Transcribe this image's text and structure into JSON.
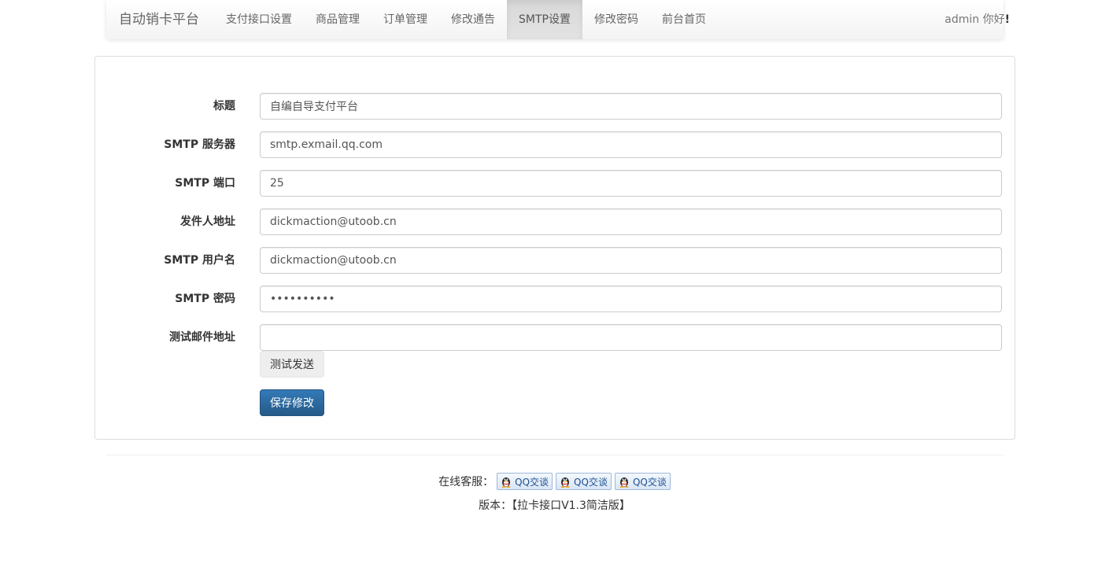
{
  "navbar": {
    "brand": "自动销卡平台",
    "items": [
      {
        "label": "支付接口设置"
      },
      {
        "label": "商品管理"
      },
      {
        "label": "订单管理"
      },
      {
        "label": "修改通告"
      },
      {
        "label": "SMTP设置",
        "active": true
      },
      {
        "label": "修改密码"
      },
      {
        "label": "前台首页"
      }
    ],
    "user_greeting": "admin 你好",
    "user_suffix": "!"
  },
  "form": {
    "fields": [
      {
        "label": "标题",
        "value": "自编自导支付平台"
      },
      {
        "label": "SMTP 服务器",
        "value": "smtp.exmail.qq.com"
      },
      {
        "label": "SMTP 端口",
        "value": "25"
      },
      {
        "label": "发件人地址",
        "value": "dickmaction@utoob.cn"
      },
      {
        "label": "SMTP 用户名",
        "value": "dickmaction@utoob.cn"
      },
      {
        "label": "SMTP 密码",
        "value": "••••••••••"
      },
      {
        "label": "测试邮件地址",
        "value": ""
      }
    ],
    "test_send_label": "测试发送",
    "save_label": "保存修改"
  },
  "footer": {
    "service_label": "在线客服：",
    "qq_buttons": [
      {
        "label": "QQ交谈"
      },
      {
        "label": "QQ交谈"
      },
      {
        "label": "QQ交谈"
      }
    ],
    "version": "版本：【拉卡接口V1.3简洁版】"
  },
  "colors": {
    "primary": "#337ab7",
    "nav_active": "#dddddd"
  }
}
